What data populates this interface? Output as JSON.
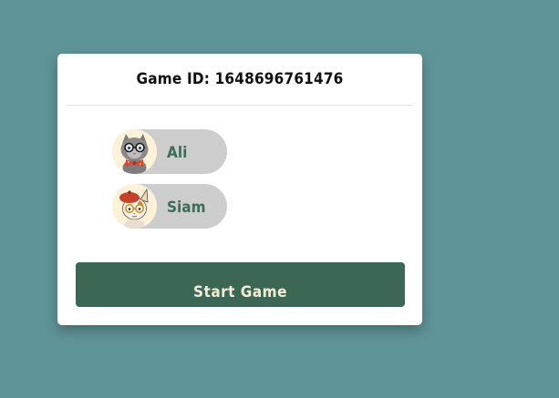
{
  "game": {
    "id_label": "Game ID: 1648696761476"
  },
  "players": [
    {
      "name": "Ali",
      "avatar": "cat-with-glasses-and-bowtie-icon"
    },
    {
      "name": "Siam",
      "avatar": "cat-with-beret-and-glasses-icon"
    }
  ],
  "actions": {
    "start_label": "Start Game"
  },
  "colors": {
    "background": "#5f9499",
    "card": "#ffffff",
    "pill": "#cdcdcd",
    "player_name": "#3f6b59",
    "button": "#3c6755",
    "button_text": "#f3ecd6"
  }
}
